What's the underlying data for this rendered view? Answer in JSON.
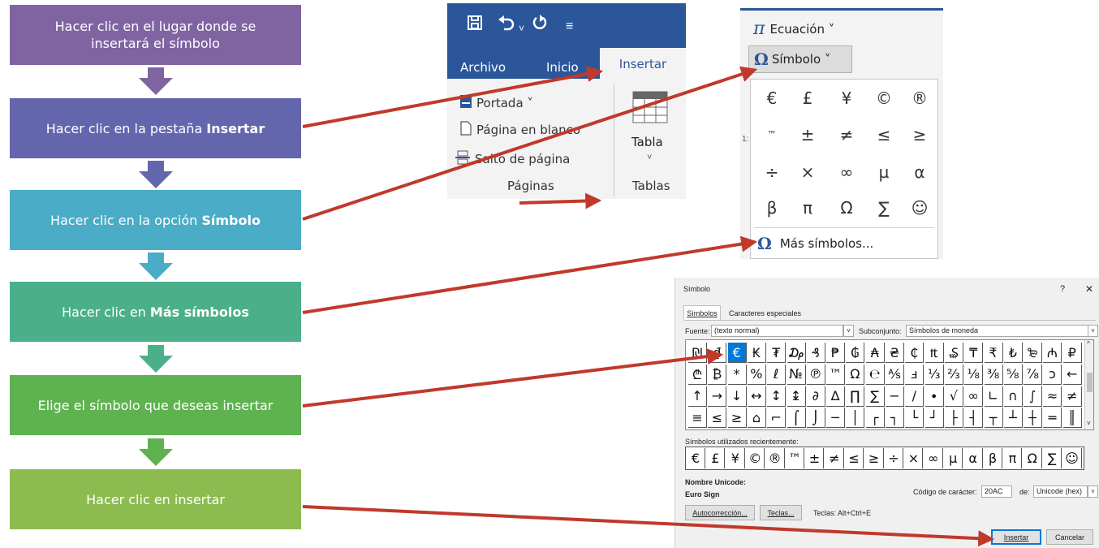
{
  "flow": {
    "steps": [
      {
        "text": "Hacer clic en el lugar donde se insertará el símbolo",
        "bold": "",
        "color": "#8064a2"
      },
      {
        "text": "Hacer clic en la pestaña ",
        "bold": "Insertar",
        "color": "#6466ad"
      },
      {
        "text": "Hacer clic en la opción ",
        "bold": "Símbolo",
        "color": "#4aacc6"
      },
      {
        "text": "Hacer clic en ",
        "bold": "Más símbolos",
        "color": "#4bb08a"
      },
      {
        "text": "Elige el símbolo que deseas insertar",
        "bold": "",
        "color": "#5fb250"
      },
      {
        "text": "Hacer clic en insertar",
        "bold": "",
        "color": "#8cbc50"
      }
    ],
    "arrow_colors": [
      "#8064a2",
      "#6466ad",
      "#4aacc6",
      "#4bb08a",
      "#5fb250"
    ]
  },
  "ribbon": {
    "tabs": [
      "Archivo",
      "Inicio"
    ],
    "active_tab": "Insertar",
    "items": [
      "Portada ˅",
      "Página en blanco",
      "Salto de página"
    ],
    "group_pages": "Páginas",
    "table_label": "Tabla",
    "table_chevron": "˅",
    "group_tables": "Tablas",
    "bg": "#2b579a"
  },
  "symbol_menu": {
    "equation_label": "Ecuación ˅",
    "symbol_label": "Símbolo ˅",
    "symbols": [
      "€",
      "£",
      "¥",
      "©",
      "®",
      "™",
      "±",
      "≠",
      "≤",
      "≥",
      "÷",
      "×",
      "∞",
      "µ",
      "α",
      "β",
      "π",
      "Ω",
      "∑",
      "☺"
    ],
    "more_label": "Más símbolos...",
    "side_digits": "1:"
  },
  "dialog": {
    "title": "Símbolo",
    "help": "?",
    "close": "✕",
    "tab_symbols": "Símbolos",
    "tab_special": "Caracteres especiales",
    "font_label": "Fuente:",
    "font_value": "(texto normal)",
    "subset_label": "Subconjunto:",
    "subset_value": "Símbolos de moneda",
    "grid": [
      "₪",
      "₫",
      "€",
      "₭",
      "₮",
      "₯",
      "₰",
      "₱",
      "₲",
      "₳",
      "₴",
      "₵",
      "₶",
      "₷",
      "₸",
      "₹",
      "₺",
      "₻",
      "₼",
      "₽",
      "₾",
      "₿",
      "*",
      "%",
      "ℓ",
      "№",
      "℗",
      "™",
      "Ω",
      "℮",
      "⅍",
      "ⅎ",
      "⅓",
      "⅔",
      "⅛",
      "⅜",
      "⅝",
      "⅞",
      "ↄ",
      "←",
      "↑",
      "→",
      "↓",
      "↔",
      "↕",
      "↨",
      "∂",
      "∆",
      "∏",
      "∑",
      "−",
      "∕",
      "∙",
      "√",
      "∞",
      "∟",
      "∩",
      "∫",
      "≈",
      "≠",
      "≡",
      "≤",
      "≥",
      "⌂",
      "⌐",
      "⌠",
      "⌡",
      "─",
      "│",
      "┌",
      "┐",
      "└",
      "┘",
      "├",
      "┤",
      "┬",
      "┴",
      "┼",
      "═",
      "║"
    ],
    "selected_index": 2,
    "recent_label": "Símbolos utilizados recientemente:",
    "recent": [
      "€",
      "£",
      "¥",
      "©",
      "®",
      "™",
      "±",
      "≠",
      "≤",
      "≥",
      "÷",
      "×",
      "∞",
      "µ",
      "α",
      "β",
      "π",
      "Ω",
      "∑",
      "☺"
    ],
    "unicode_name_label": "Nombre Unicode:",
    "unicode_name": "Euro Sign",
    "char_code_label": "Código de carácter:",
    "char_code": "20AC",
    "from_label": "de:",
    "from_value": "Unicode (hex)",
    "autocorrect_btn": "Autocorrección...",
    "keys_btn": "Teclas...",
    "keys_text": "Teclas: Alt+Ctrl+E",
    "insert_btn": "Insertar",
    "cancel_btn": "Cancelar"
  },
  "colors": {
    "connector": "#c0392b",
    "accent": "#2b579a",
    "selected_cell": "#0078d7"
  }
}
